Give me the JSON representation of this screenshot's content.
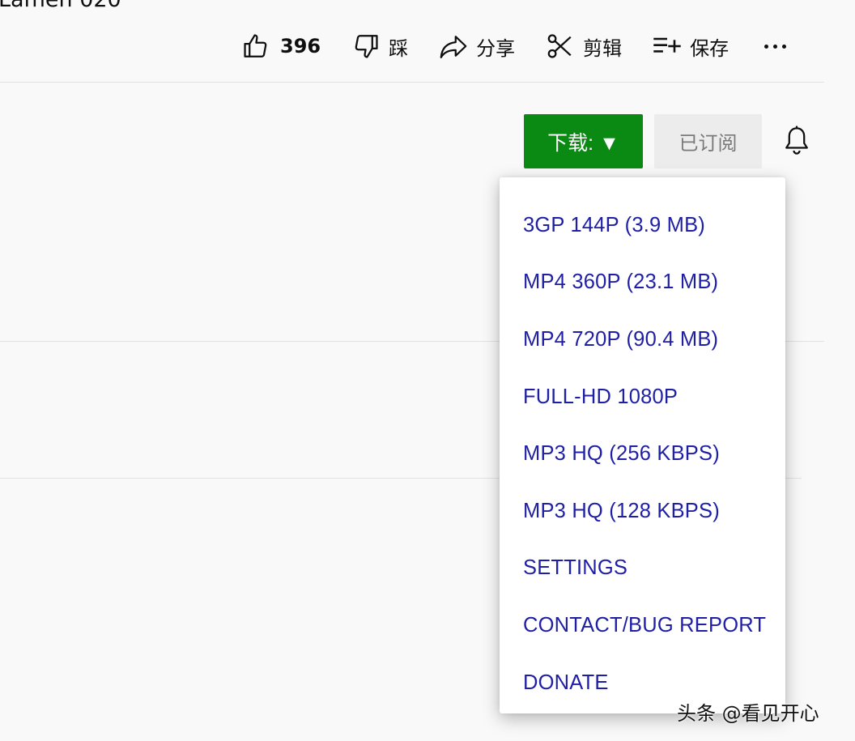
{
  "video": {
    "title_fragment": "Lamen 020"
  },
  "actions": {
    "like_count": "396",
    "dislike_label": "踩",
    "share_label": "分享",
    "clip_label": "剪辑",
    "save_label": "保存"
  },
  "channel": {
    "download_label": "下载: ▼",
    "subscribed_label": "已订阅"
  },
  "download_menu": {
    "items": [
      "3GP 144P (3.9 MB)",
      "MP4 360P (23.1 MB)",
      "MP4 720P (90.4 MB)",
      "FULL-HD 1080P",
      "MP3 HQ (256 KBPS)",
      "MP3 HQ (128 KBPS)",
      "SETTINGS",
      "CONTACT/BUG REPORT",
      "DONATE"
    ]
  },
  "watermark": {
    "text": "头条 @看见开心"
  },
  "icons": {
    "like": "thumbs-up-icon",
    "dislike": "thumbs-down-icon",
    "share": "share-arrow-icon",
    "clip": "scissors-icon",
    "save": "playlist-add-icon",
    "more": "more-horizontal-icon",
    "bell": "bell-icon"
  },
  "colors": {
    "download_button_bg": "#0a8a13",
    "menu_link": "#1f1fa6",
    "subscribed_bg": "#ececec"
  }
}
